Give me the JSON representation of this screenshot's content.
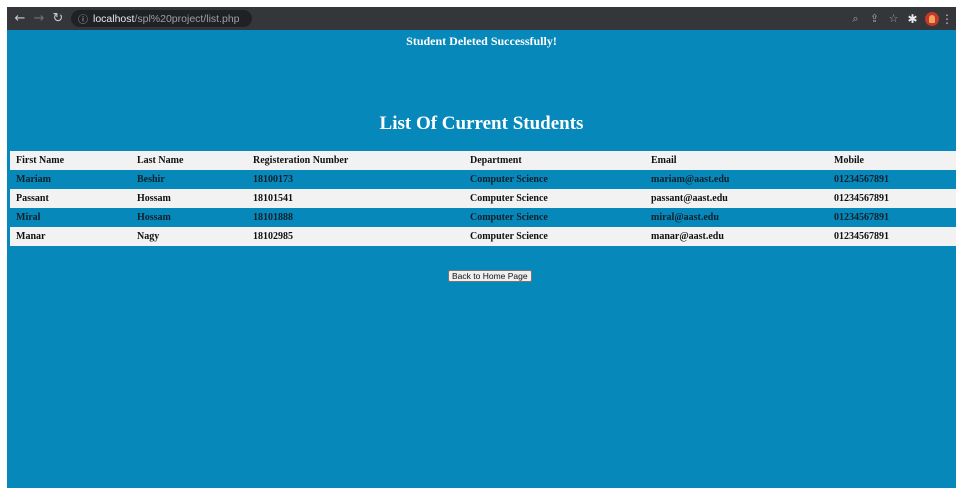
{
  "browser": {
    "url_host": "localhost",
    "url_path": "/spl%20project/list.php"
  },
  "page": {
    "message": "Student Deleted Successfully!",
    "heading": "List Of Current Students",
    "back_button_label": "Back to Home Page"
  },
  "table": {
    "headers": [
      "First Name",
      "Last Name",
      "Registeration Number",
      "Department",
      "Email",
      "Mobile"
    ],
    "rows": [
      [
        "Mariam",
        "Beshir",
        "18100173",
        "Computer Science",
        "mariam@aast.edu",
        "01234567891"
      ],
      [
        "Passant",
        "Hossam",
        "18101541",
        "Computer Science",
        "passant@aast.edu",
        "01234567891"
      ],
      [
        "Miral",
        "Hossam",
        "18101888",
        "Computer Science",
        "miral@aast.edu",
        "01234567891"
      ],
      [
        "Manar",
        "Nagy",
        "18102985",
        "Computer Science",
        "manar@aast.edu",
        "01234567891"
      ]
    ]
  },
  "colors": {
    "page_background": "#0788bb",
    "row_light": "#f2f2f2",
    "browser_toolbar": "#35363a"
  },
  "icons": {
    "back": "arrow-left",
    "forward": "arrow-right",
    "reload": "reload",
    "site_info": "info-circle",
    "zoom": "magnifier",
    "share": "share",
    "bookmark": "star",
    "extensions": "puzzle",
    "menu": "vertical-dots"
  }
}
